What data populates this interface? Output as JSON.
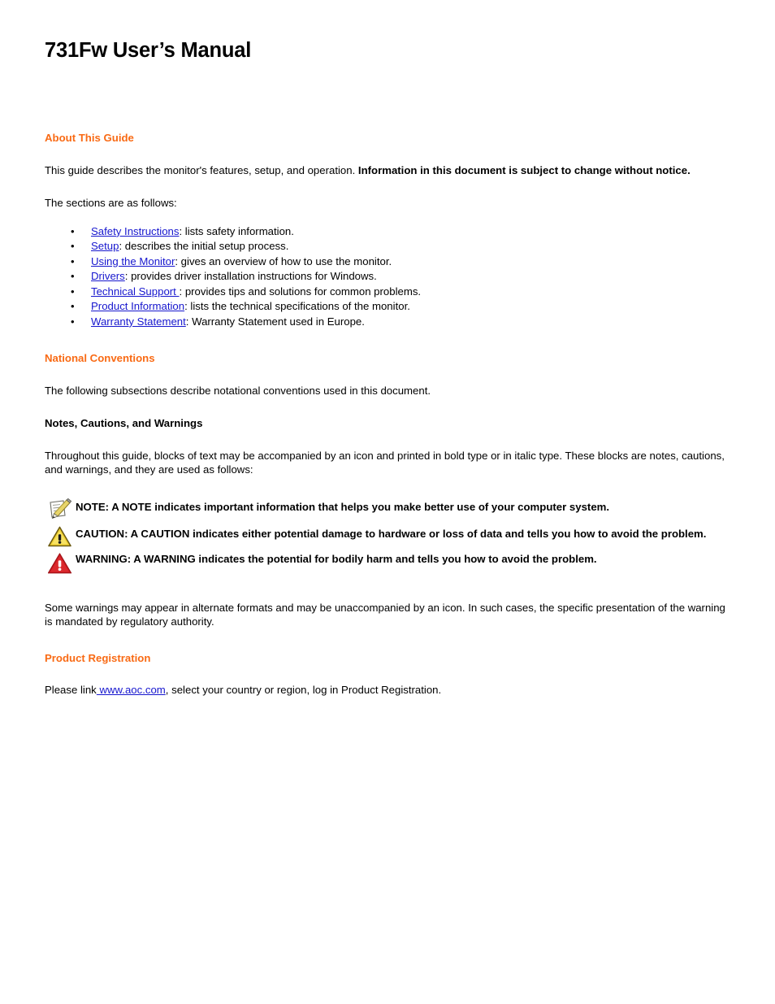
{
  "document": {
    "title": "731Fw User’s Manual"
  },
  "colors": {
    "heading_orange": "#F96A14",
    "link_blue": "#1616CE",
    "text_black": "#000000",
    "caution_triangle": "#F2D232",
    "warning_triangle": "#D01B22",
    "page_background": "#FFFFFF"
  },
  "sections": {
    "about": {
      "heading": "About This Guide",
      "intro_normal": "This guide describes the monitor's features, setup, and operation. ",
      "intro_bold": "Information in this document is subject to change without notice.",
      "sections_lead": "The sections are as follows:",
      "items": [
        {
          "link": "Safety Instructions",
          "rest": ": lists safety information."
        },
        {
          "link": "Setup",
          "rest": ": describes the initial setup process."
        },
        {
          "link": "Using the Monitor",
          "rest": ": gives an overview of how to use the monitor."
        },
        {
          "link": "Drivers",
          "rest": ": provides driver installation instructions for Windows."
        },
        {
          "link": "Technical Support ",
          "rest": ": provides tips and solutions for common problems."
        },
        {
          "link": "Product Information",
          "rest": ": lists the technical specifications of the monitor."
        },
        {
          "link": "Warranty Statement",
          "rest": ": Warranty Statement used in Europe."
        }
      ]
    },
    "national_conventions": {
      "heading": "National Conventions",
      "intro": "The following subsections describe notational conventions used in this document.",
      "sub_heading": "Notes, Cautions, and Warnings",
      "body": "Throughout this guide, blocks of text may be accompanied by an icon and printed in bold type or in italic type. These blocks are notes, cautions, and warnings, and they are used as follows:",
      "notices": [
        {
          "icon": "note-pencil-icon",
          "text": "NOTE: A NOTE indicates important information that helps you make better use of your computer system."
        },
        {
          "icon": "caution-triangle-icon",
          "text": "CAUTION: A CAUTION indicates either potential damage to hardware or loss of data and tells you how to avoid the problem."
        },
        {
          "icon": "warning-triangle-icon",
          "text": "WARNING: A WARNING indicates the potential for bodily harm and tells you how to avoid the problem."
        }
      ],
      "closing": "Some warnings may appear in alternate formats and may be unaccompanied by an icon. In such cases, the specific presentation of the warning is mandated by regulatory authority."
    },
    "product_registration": {
      "heading": "Product Registration",
      "prefix": "Please link",
      "link": " www.aoc.com",
      "suffix": ", select your country or region, log in Product Registration."
    }
  }
}
